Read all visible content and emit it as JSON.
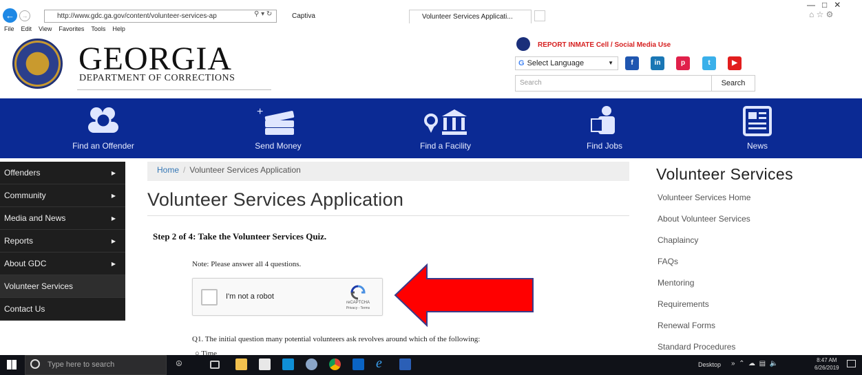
{
  "browser": {
    "address": "http://www.gdc.ga.gov/content/volunteer-services-ap",
    "tabs": [
      "Captiva",
      "Volunteer Services Applicati..."
    ],
    "menu": [
      "File",
      "Edit",
      "View",
      "Favorites",
      "Tools",
      "Help"
    ]
  },
  "header": {
    "title": "GEORGIA",
    "subtitle": "DEPARTMENT OF CORRECTIONS",
    "report": "REPORT INMATE Cell / Social Media Use",
    "language": "Select Language",
    "search_placeholder": "Search",
    "search_button": "Search"
  },
  "nav": [
    "Find an Offender",
    "Send Money",
    "Find a Facility",
    "Find Jobs",
    "News"
  ],
  "sidebar": [
    "Offenders",
    "Community",
    "Media and News",
    "Reports",
    "About GDC",
    "Volunteer Services",
    "Contact Us"
  ],
  "breadcrumb": {
    "home": "Home",
    "sep": "/",
    "current": "Volunteer Services Application"
  },
  "page": {
    "title": "Volunteer Services Application",
    "step": "Step 2 of 4: Take the Volunteer Services Quiz.",
    "note": "Note: Please answer all 4 questions.",
    "captcha_label": "I'm not a robot",
    "captcha_brand": "reCAPTCHA",
    "captcha_terms": "Privacy - Terms",
    "q1": "Q1. The initial question many potential volunteers ask revolves around which of the following:",
    "option1": "Time"
  },
  "right": {
    "title": "Volunteer Services",
    "links": [
      "Volunteer Services Home",
      "About Volunteer Services",
      "Chaplaincy",
      "FAQs",
      "Mentoring",
      "Requirements",
      "Renewal Forms",
      "Standard Procedures"
    ]
  },
  "taskbar": {
    "search": "Type here to search",
    "desktop": "Desktop",
    "time": "8:47 AM",
    "date": "6/26/2019"
  },
  "colors": {
    "nav_bg": "#0b2a94",
    "arrow": "#ff0000",
    "sidebar_bg": "#1e1e1e"
  }
}
